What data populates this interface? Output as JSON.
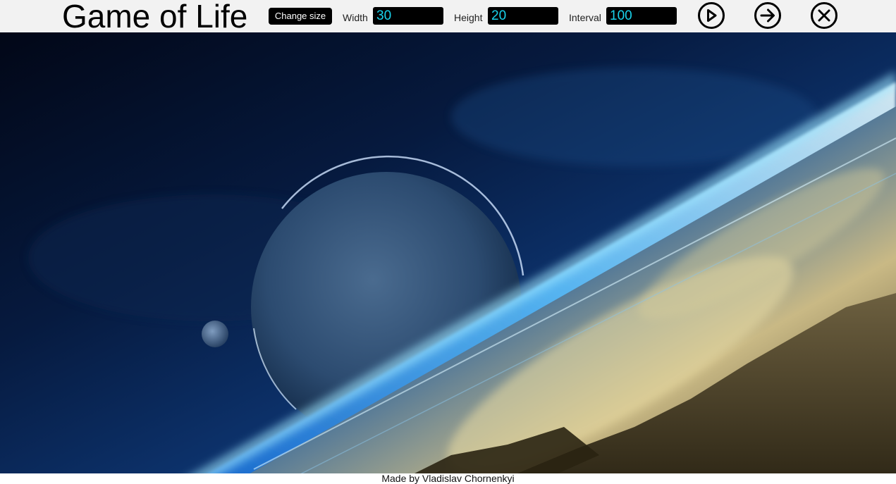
{
  "header": {
    "title": "Game of Life",
    "change_size_label": "Change size",
    "width_label": "Width",
    "width_value": "30",
    "height_label": "Height",
    "height_value": "20",
    "interval_label": "Interval",
    "interval_value": "100"
  },
  "controls": {
    "play_icon": "play-circle-icon",
    "step_icon": "arrow-right-circle-icon",
    "clear_icon": "close-circle-icon"
  },
  "colors": {
    "field_bg": "#000000",
    "field_text": "#19d3ec",
    "header_bg": "#f2f2f2"
  },
  "footer": {
    "credit": "Made by Vladislav Chornenkyi"
  }
}
